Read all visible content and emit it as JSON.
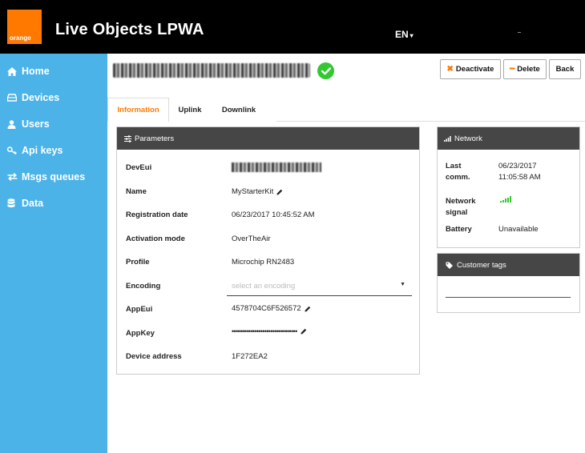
{
  "header": {
    "logo_text": "orange",
    "title": "Live Objects LPWA",
    "language": "EN",
    "brand_color": "#ff7900"
  },
  "sidebar": {
    "color": "#4bb3e8",
    "items": [
      {
        "label": "Home",
        "icon": "home-icon"
      },
      {
        "label": "Devices",
        "icon": "devices-icon"
      },
      {
        "label": "Users",
        "icon": "user-icon"
      },
      {
        "label": "Api keys",
        "icon": "key-icon"
      },
      {
        "label": "Msgs queues",
        "icon": "exchange-icon"
      },
      {
        "label": "Data",
        "icon": "database-icon"
      }
    ]
  },
  "device": {
    "status_icon": "check-circle-icon",
    "actions": {
      "deactivate": "Deactivate",
      "delete": "Delete",
      "back": "Back"
    }
  },
  "tabs": [
    {
      "label": "Information",
      "active": true
    },
    {
      "label": "Uplink",
      "active": false
    },
    {
      "label": "Downlink",
      "active": false
    }
  ],
  "parameters": {
    "title": "Parameters",
    "rows": {
      "deveui": {
        "label": "DevEui"
      },
      "name": {
        "label": "Name",
        "value": "MyStarterKit"
      },
      "registration": {
        "label": "Registration date",
        "value": "06/23/2017 10:45:52 AM"
      },
      "activation": {
        "label": "Activation mode",
        "value": "OverTheAir"
      },
      "profile": {
        "label": "Profile",
        "value": "Microchip RN2483"
      },
      "encoding": {
        "label": "Encoding",
        "placeholder": "select an encoding"
      },
      "appeui": {
        "label": "AppEui",
        "value": "4578704C6F526572"
      },
      "appkey": {
        "label": "AppKey",
        "value": "••••••••••••••••••••••••••••••••"
      },
      "address": {
        "label": "Device address",
        "value": "1F272EA2"
      }
    }
  },
  "network": {
    "title": "Network",
    "last_comm_label_1": "Last",
    "last_comm_label_2": "comm.",
    "last_comm_date": "06/23/2017",
    "last_comm_time": "11:05:58 AM",
    "signal_label_1": "Network",
    "signal_label_2": "signal",
    "signal_level": 5,
    "battery_label": "Battery",
    "battery_value": "Unavailable"
  },
  "customer_tags": {
    "title": "Customer tags"
  }
}
